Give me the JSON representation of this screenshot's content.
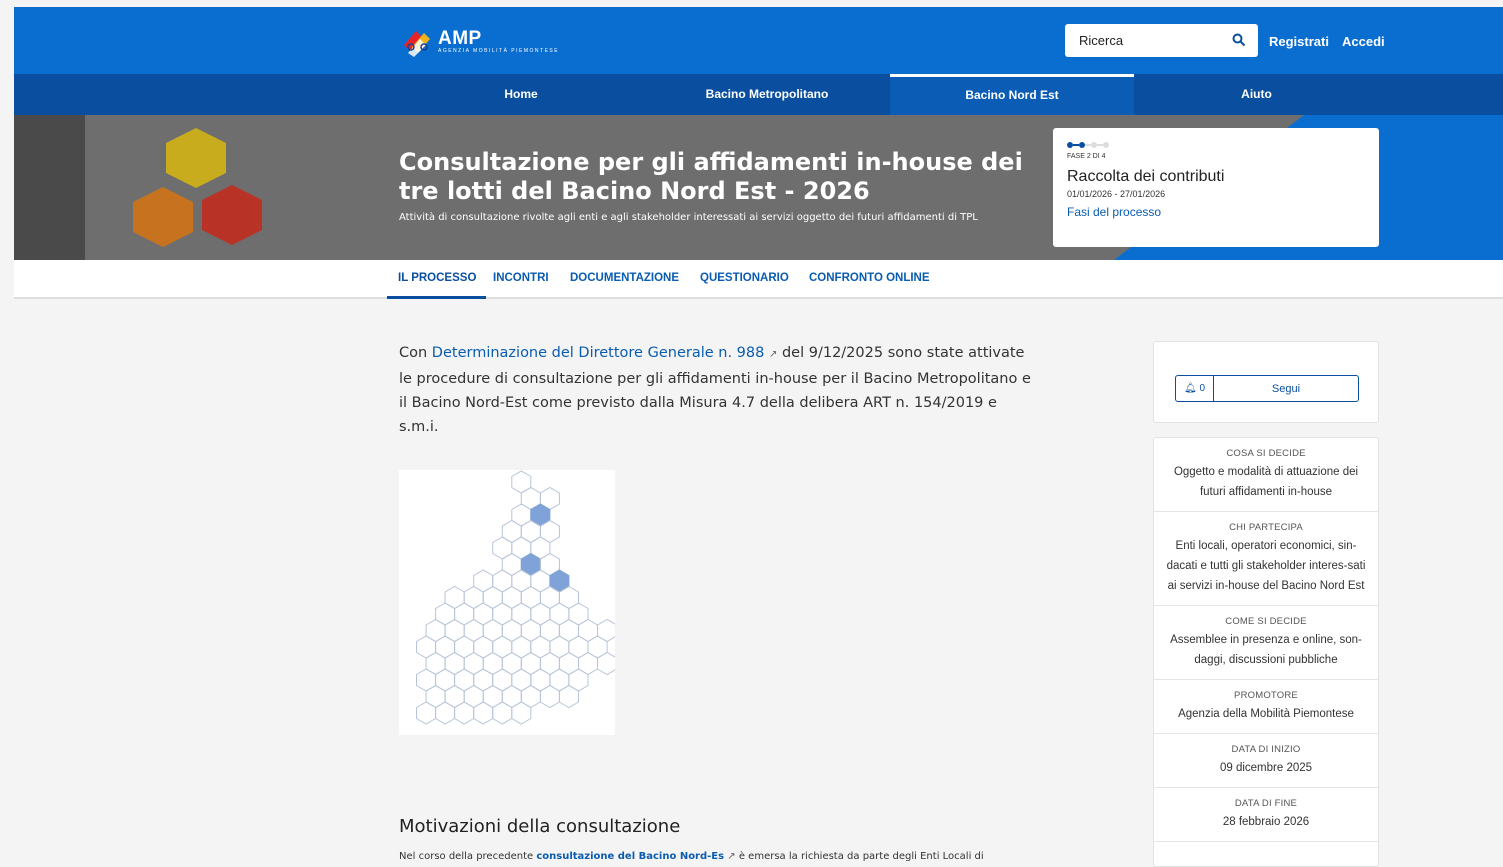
{
  "header": {
    "logo_text": "AMP",
    "logo_sub": "AGENZIA MOBILITÀ PIEMONTESE",
    "search_placeholder": "Ricerca",
    "register_label": "Registrati",
    "login_label": "Accedi"
  },
  "nav": {
    "items": [
      {
        "label": "Home"
      },
      {
        "label": "Bacino Metropolitano"
      },
      {
        "label": "Bacino Nord Est"
      },
      {
        "label": "Aiuto"
      }
    ],
    "active": "Bacino Nord Est"
  },
  "hero": {
    "title": "Consultazione per gli affidamenti in-house dei tre lotti del Bacino Nord Est - 2026",
    "subtitle": "Attività di consultazione rivolte agli enti e agli stakeholder interessati ai servizi oggetto dei futuri affidamenti di TPL",
    "phase": {
      "step": "FASE 2 DI 4",
      "name": "Raccolta dei contributi",
      "dates": "01/01/2026 - 27/01/2026",
      "link": "Fasi del processo",
      "current": 2,
      "total": 4
    }
  },
  "tabs": [
    {
      "label": "IL PROCESSO"
    },
    {
      "label": "INCONTRI"
    },
    {
      "label": "DOCUMENTAZIONE"
    },
    {
      "label": "QUESTIONARIO"
    },
    {
      "label": "CONFRONTO ONLINE"
    }
  ],
  "content": {
    "intro_before": "Con ",
    "intro_link": "Determinazione del Direttore Generale n. 988",
    "intro_after": " del 9/12/2025 sono state attivate le procedure di consultazione per gli affidamenti in-house per il Bacino Metropolitano e il Bacino Nord-Est come previsto dalla Misura 4.7 della delibera ART n. 154/2019 e s.m.i.",
    "section_title": "Motivazioni della consultazione",
    "para_before": "Nel corso della precedente ",
    "para_link": "consultazione del Bacino Nord-Es",
    "para_after": " è emersa la richiesta da parte degli Enti Locali di"
  },
  "sidebar": {
    "follow_count": "0",
    "follow_label": "Segui",
    "info": [
      {
        "label": "COSA SI DECIDE",
        "value": "Oggetto e modalità di attuazione dei futuri affidamenti in-house"
      },
      {
        "label": "CHI PARTECIPA",
        "value": "Enti locali, operatori economici, sin-dacati e tutti gli stakeholder interes-sati ai servizi in-house del Bacino Nord Est"
      },
      {
        "label": "COME SI DECIDE",
        "value": "Assemblee in presenza e online, son-daggi, discussioni pubbliche"
      },
      {
        "label": "PROMOTORE",
        "value": "Agenzia della Mobilità Piemontese"
      },
      {
        "label": "DATA DI INIZIO",
        "value": "09 dicembre 2025"
      },
      {
        "label": "DATA DI FINE",
        "value": "28 febbraio 2026"
      }
    ]
  },
  "colors": {
    "primary_blue": "#0a6ed1",
    "nav_blue": "#0a4f9f",
    "link_blue": "#0a5cb0",
    "hex_yellow": "#c9ac1e",
    "hex_orange": "#c6721e",
    "hex_red": "#b83326",
    "map_fill": "#7fa2d8"
  }
}
